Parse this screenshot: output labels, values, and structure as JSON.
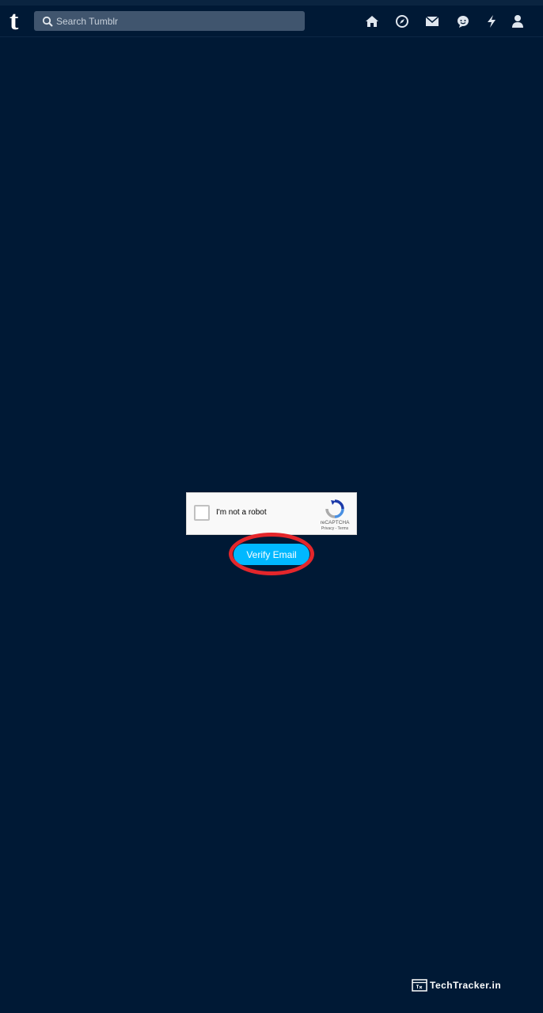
{
  "header": {
    "logo": "t",
    "search_placeholder": "Search Tumblr",
    "nav_icons": [
      "home-icon",
      "explore-icon",
      "mail-icon",
      "chat-icon",
      "activity-icon",
      "account-icon"
    ]
  },
  "captcha": {
    "label": "I'm not a robot",
    "brand": "reCAPTCHA",
    "links": "Privacy - Terms"
  },
  "verify": {
    "button_label": "Verify Email"
  },
  "watermark": {
    "text": "TechTracker.in"
  },
  "colors": {
    "background": "#001935",
    "search_bg": "#40556e",
    "button": "#00b8ff",
    "highlight": "#e4262b"
  }
}
